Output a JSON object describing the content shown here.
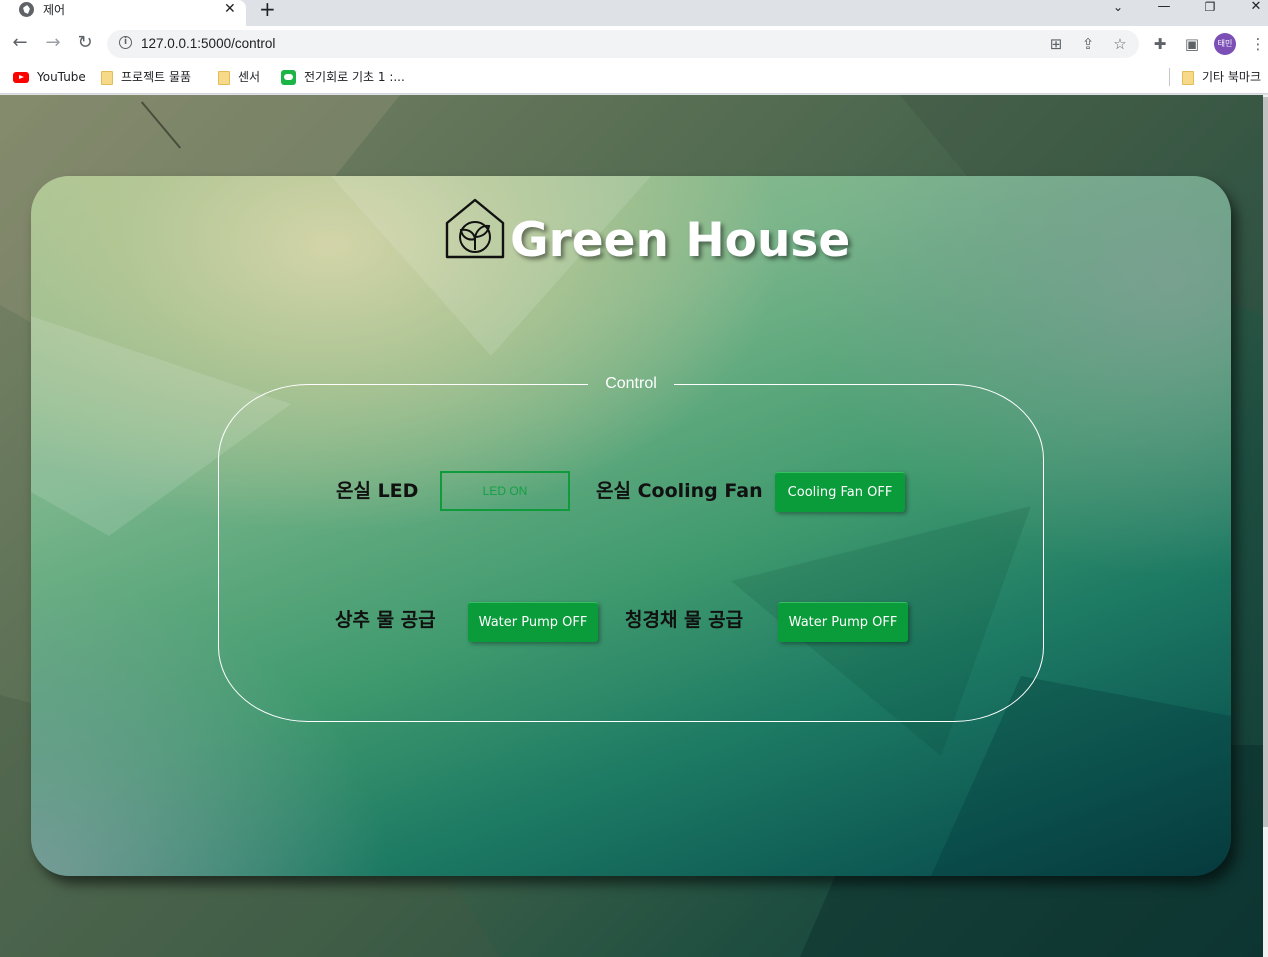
{
  "browser": {
    "tab_title": "제어",
    "url": "127.0.0.1:5000/control",
    "profile_initials": "태민",
    "bookmarks": [
      {
        "label": "YouTube",
        "icon": "youtube-icon"
      },
      {
        "label": "프로젝트 물품",
        "icon": "folder-icon"
      },
      {
        "label": "센서",
        "icon": "folder-icon"
      },
      {
        "label": "전기회로 기초 1 :...",
        "icon": "line-icon"
      }
    ],
    "other_bookmarks": "기타 북마크"
  },
  "page": {
    "brand": "Green House",
    "control_legend": "Control",
    "controls": [
      {
        "label": "온실 LED",
        "button": "LED ON"
      },
      {
        "label": "온실 Cooling Fan",
        "button": "Cooling Fan OFF"
      },
      {
        "label": "상추 물 공급",
        "button": "Water Pump OFF"
      },
      {
        "label": "청경채 물 공급",
        "button": "Water Pump OFF"
      }
    ]
  },
  "colors": {
    "button_green": "#0a9b3a",
    "outline_green": "#0f9a3c",
    "brand_text": "#ffffff"
  }
}
